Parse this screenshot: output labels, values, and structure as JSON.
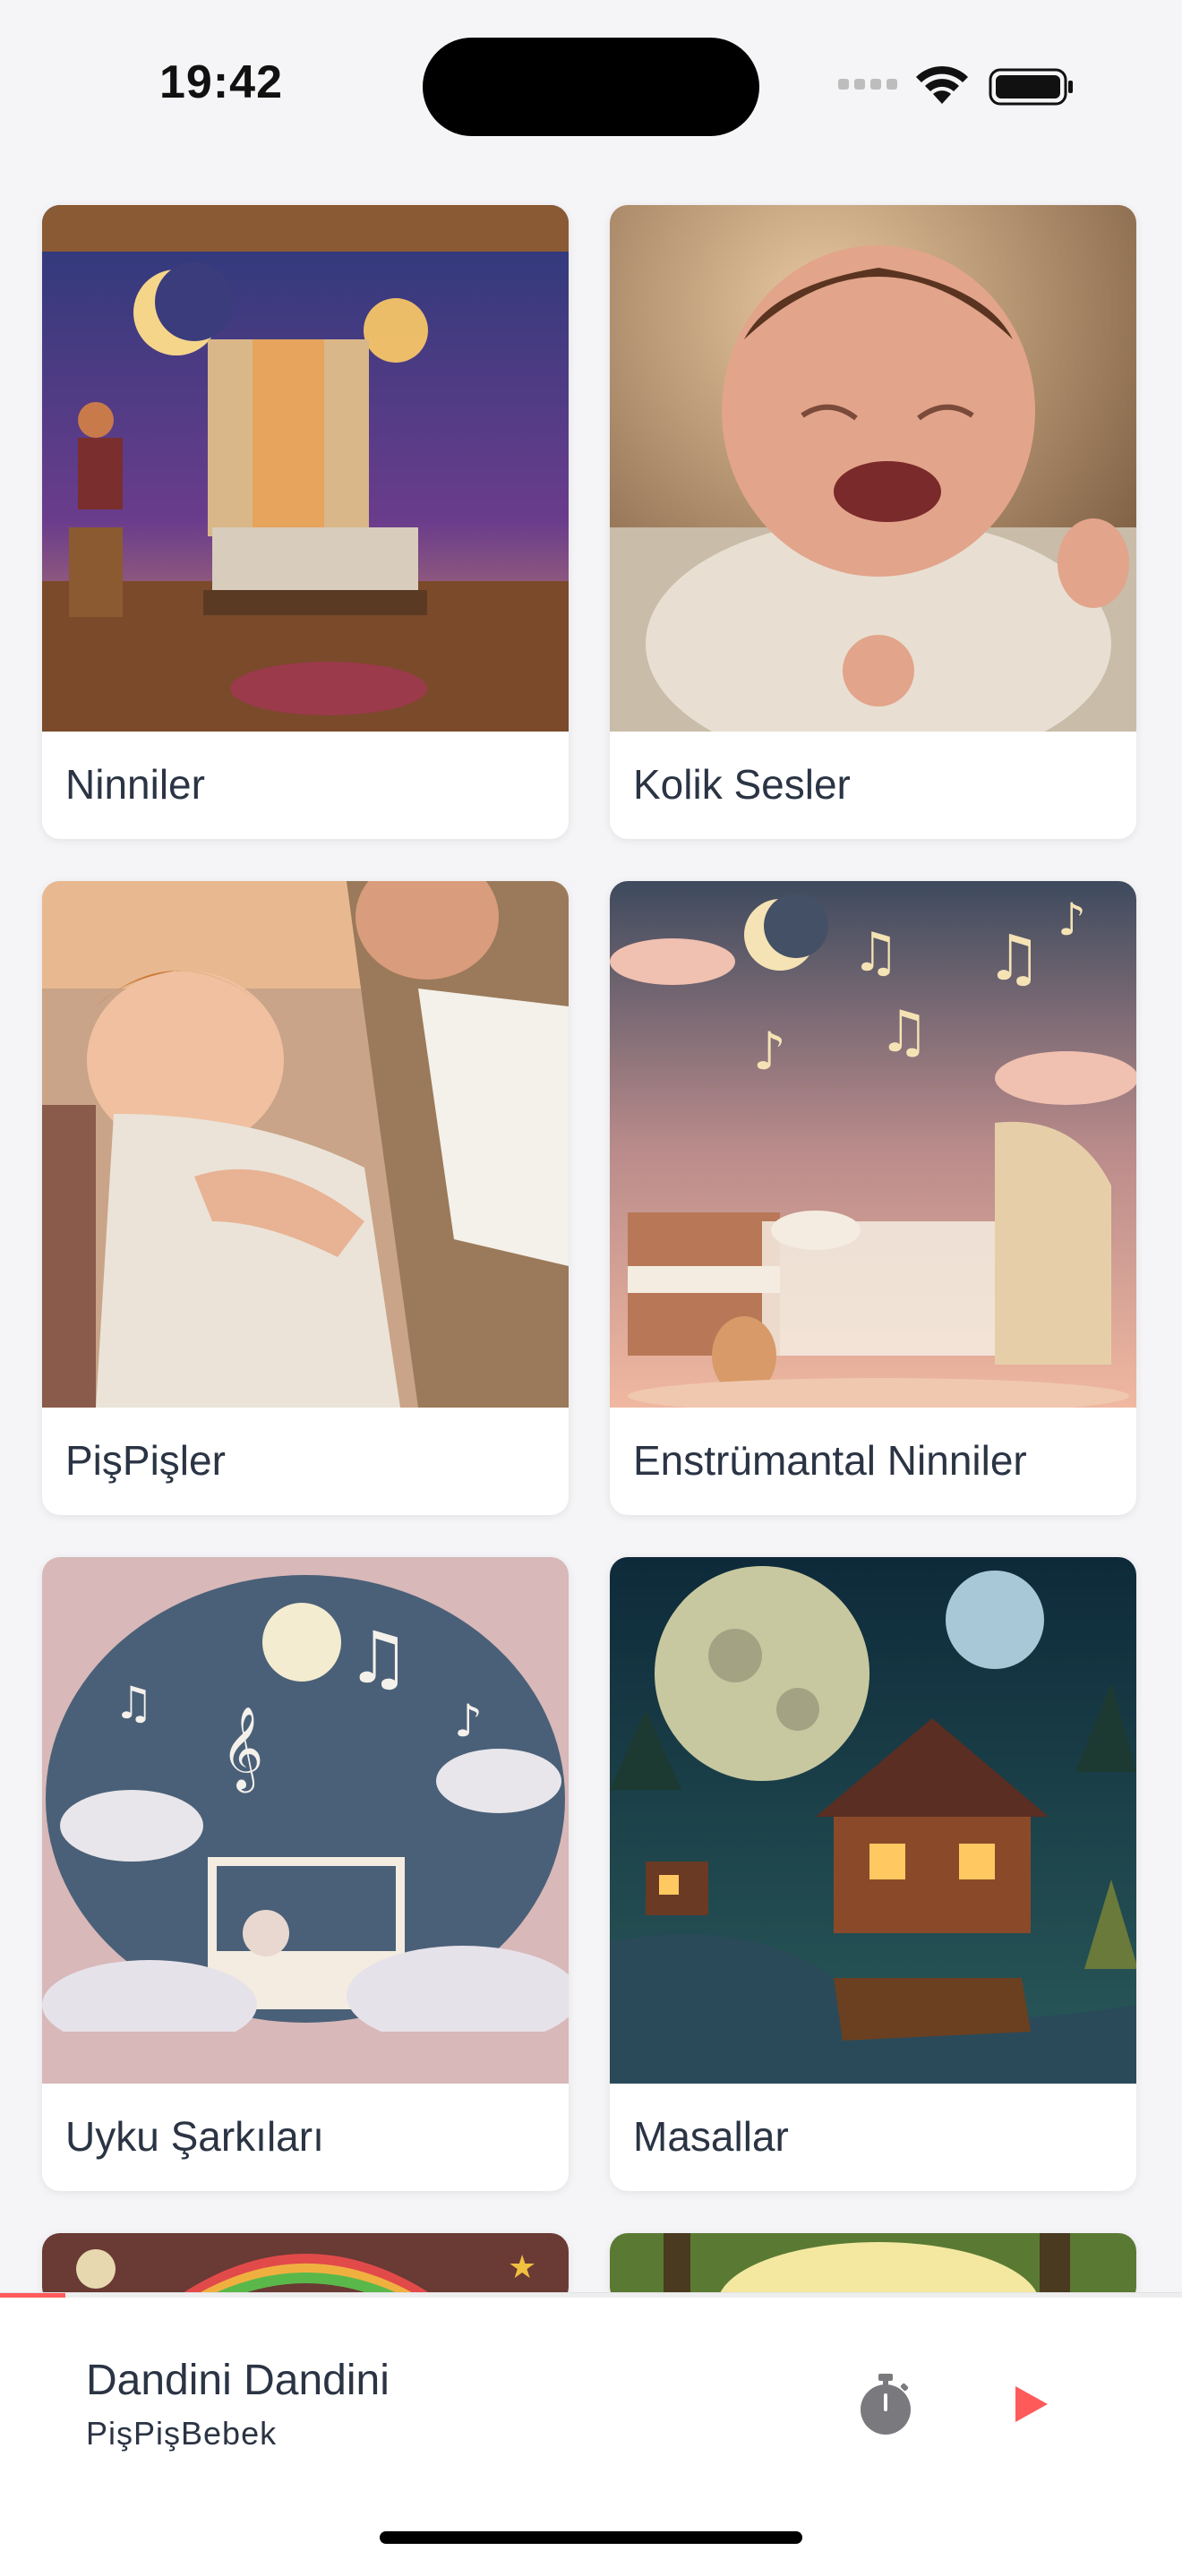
{
  "status_bar": {
    "time": "19:42",
    "icons": [
      "signal-icon",
      "wifi-icon",
      "battery-icon"
    ]
  },
  "categories": [
    {
      "label": "Ninniler",
      "image": "cozy-night-room-lullaby-illustration"
    },
    {
      "label": "Kolik Sesler",
      "image": "crying-baby-photo"
    },
    {
      "label": "PişPişler",
      "image": "sleeping-baby-in-arms-photo"
    },
    {
      "label": "Enstrümantal Ninniler",
      "image": "baby-crib-with-instruments-and-notes"
    },
    {
      "label": "Uyku Şarkıları",
      "image": "crib-under-moon-with-music-notes"
    },
    {
      "label": "Masallar",
      "image": "cabin-under-full-moon-illustration"
    },
    {
      "label": "",
      "image": "rainbow-nursery-illustration"
    },
    {
      "label": "",
      "image": "sunlit-forest-illustration"
    }
  ],
  "player": {
    "title": "Dandini Dandini",
    "artist": "PişPişBebek",
    "progress": 0.055,
    "icons": {
      "timer": "stopwatch-icon",
      "play": "play-icon"
    },
    "accent_color": "#ff5a5a"
  }
}
